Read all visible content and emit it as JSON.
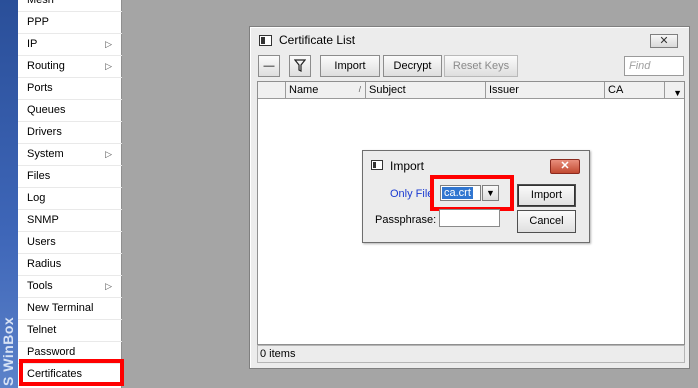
{
  "brand_strip": {
    "text": "S WinBox"
  },
  "sidebar": {
    "items": [
      {
        "label": "Mesh",
        "submenu": false
      },
      {
        "label": "PPP",
        "submenu": false
      },
      {
        "label": "IP",
        "submenu": true
      },
      {
        "label": "Routing",
        "submenu": true
      },
      {
        "label": "Ports",
        "submenu": false
      },
      {
        "label": "Queues",
        "submenu": false
      },
      {
        "label": "Drivers",
        "submenu": false
      },
      {
        "label": "System",
        "submenu": true
      },
      {
        "label": "Files",
        "submenu": false
      },
      {
        "label": "Log",
        "submenu": false
      },
      {
        "label": "SNMP",
        "submenu": false
      },
      {
        "label": "Users",
        "submenu": false
      },
      {
        "label": "Radius",
        "submenu": false
      },
      {
        "label": "Tools",
        "submenu": true
      },
      {
        "label": "New Terminal",
        "submenu": false
      },
      {
        "label": "Telnet",
        "submenu": false
      },
      {
        "label": "Password",
        "submenu": false
      },
      {
        "label": "Certificates",
        "submenu": false,
        "highlighted": true
      }
    ],
    "submenu_arrow": "▷"
  },
  "cert_window": {
    "title": "Certificate List",
    "close_glyph": "✕",
    "toolbar": {
      "minus_glyph": "—",
      "filter_icon": "funnel-icon",
      "import_label": "Import",
      "decrypt_label": "Decrypt",
      "reset_keys_label": "Reset Keys"
    },
    "find_placeholder": "Find",
    "columns": [
      "Name",
      "Subject",
      "Issuer",
      "CA"
    ],
    "sort_glyph": "/",
    "dropdown_glyph": "▼",
    "status": "0 items"
  },
  "import_dialog": {
    "title": "Import",
    "close_glyph": "✕",
    "only_file_label": "Only File",
    "file_value": "ca.crt",
    "file_dropdown_glyph": "▼",
    "passphrase_label": "Passphrase:",
    "passphrase_value": "",
    "import_button": "Import",
    "cancel_button": "Cancel"
  },
  "colors": {
    "highlight": "#ff0000",
    "selection": "#3176d0",
    "label_blue": "#1b3bd1"
  }
}
